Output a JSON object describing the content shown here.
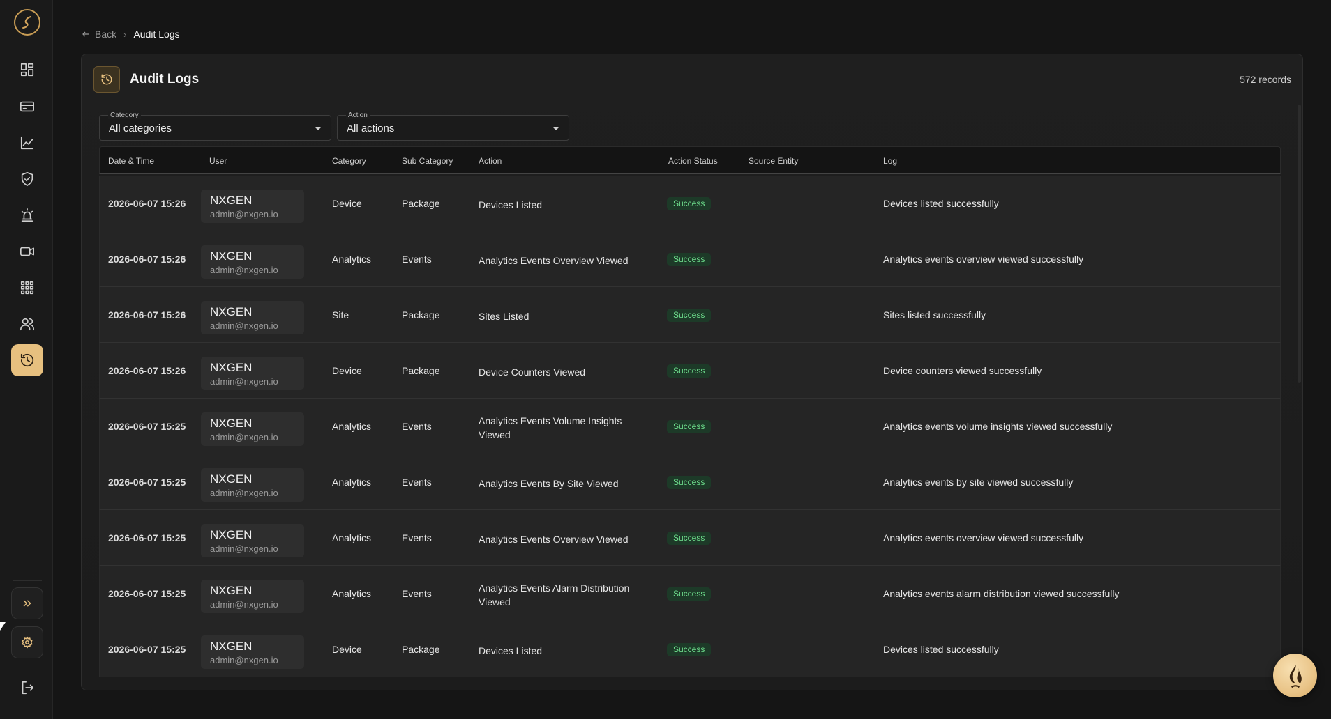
{
  "sidebar": {
    "items": [
      {
        "name": "dashboard",
        "icon": "dashboard-icon"
      },
      {
        "name": "billing",
        "icon": "card-icon"
      },
      {
        "name": "analytics",
        "icon": "chart-icon"
      },
      {
        "name": "security",
        "icon": "shield-icon"
      },
      {
        "name": "alarms",
        "icon": "alarm-icon"
      },
      {
        "name": "cameras",
        "icon": "camera-icon"
      },
      {
        "name": "video-wall",
        "icon": "grid-icon"
      },
      {
        "name": "users",
        "icon": "users-icon"
      },
      {
        "name": "audit-logs",
        "icon": "history-icon",
        "active": true
      }
    ],
    "accent_color": "#e7c07f"
  },
  "breadcrumb": {
    "back_label": "Back",
    "current": "Audit Logs"
  },
  "card": {
    "title": "Audit Logs",
    "record_count": "572 records"
  },
  "filters": {
    "category": {
      "label": "Category",
      "value": "All categories"
    },
    "action": {
      "label": "Action",
      "value": "All actions"
    }
  },
  "table": {
    "columns": [
      "Date & Time",
      "User",
      "Category",
      "Sub Category",
      "Action",
      "Action Status",
      "Source Entity",
      "Log"
    ],
    "rows": [
      {
        "date": "2026-06-07 15:26",
        "user": "NXGEN",
        "email": "admin@nxgen.io",
        "category": "Device",
        "sub": "Package",
        "action": "Devices Listed",
        "status": "Success",
        "source": "",
        "log": "Devices listed successfully"
      },
      {
        "date": "2026-06-07 15:26",
        "user": "NXGEN",
        "email": "admin@nxgen.io",
        "category": "Analytics",
        "sub": "Events",
        "action": "Analytics Events Overview Viewed",
        "status": "Success",
        "source": "",
        "log": "Analytics events overview viewed successfully"
      },
      {
        "date": "2026-06-07 15:26",
        "user": "NXGEN",
        "email": "admin@nxgen.io",
        "category": "Site",
        "sub": "Package",
        "action": "Sites Listed",
        "status": "Success",
        "source": "",
        "log": "Sites listed successfully"
      },
      {
        "date": "2026-06-07 15:26",
        "user": "NXGEN",
        "email": "admin@nxgen.io",
        "category": "Device",
        "sub": "Package",
        "action": "Device Counters Viewed",
        "status": "Success",
        "source": "",
        "log": "Device counters viewed successfully"
      },
      {
        "date": "2026-06-07 15:25",
        "user": "NXGEN",
        "email": "admin@nxgen.io",
        "category": "Analytics",
        "sub": "Events",
        "action": "Analytics Events Volume Insights Viewed",
        "status": "Success",
        "source": "",
        "log": "Analytics events volume insights viewed successfully"
      },
      {
        "date": "2026-06-07 15:25",
        "user": "NXGEN",
        "email": "admin@nxgen.io",
        "category": "Analytics",
        "sub": "Events",
        "action": "Analytics Events By Site Viewed",
        "status": "Success",
        "source": "",
        "log": "Analytics events by site viewed successfully"
      },
      {
        "date": "2026-06-07 15:25",
        "user": "NXGEN",
        "email": "admin@nxgen.io",
        "category": "Analytics",
        "sub": "Events",
        "action": "Analytics Events Overview Viewed",
        "status": "Success",
        "source": "",
        "log": "Analytics events overview viewed successfully"
      },
      {
        "date": "2026-06-07 15:25",
        "user": "NXGEN",
        "email": "admin@nxgen.io",
        "category": "Analytics",
        "sub": "Events",
        "action": "Analytics Events Alarm Distribution Viewed",
        "status": "Success",
        "source": "",
        "log": "Analytics events alarm distribution viewed successfully"
      },
      {
        "date": "2026-06-07 15:25",
        "user": "NXGEN",
        "email": "admin@nxgen.io",
        "category": "Device",
        "sub": "Package",
        "action": "Devices Listed",
        "status": "Success",
        "source": "",
        "log": "Devices listed successfully"
      }
    ]
  },
  "status_color": "#6fe08e"
}
